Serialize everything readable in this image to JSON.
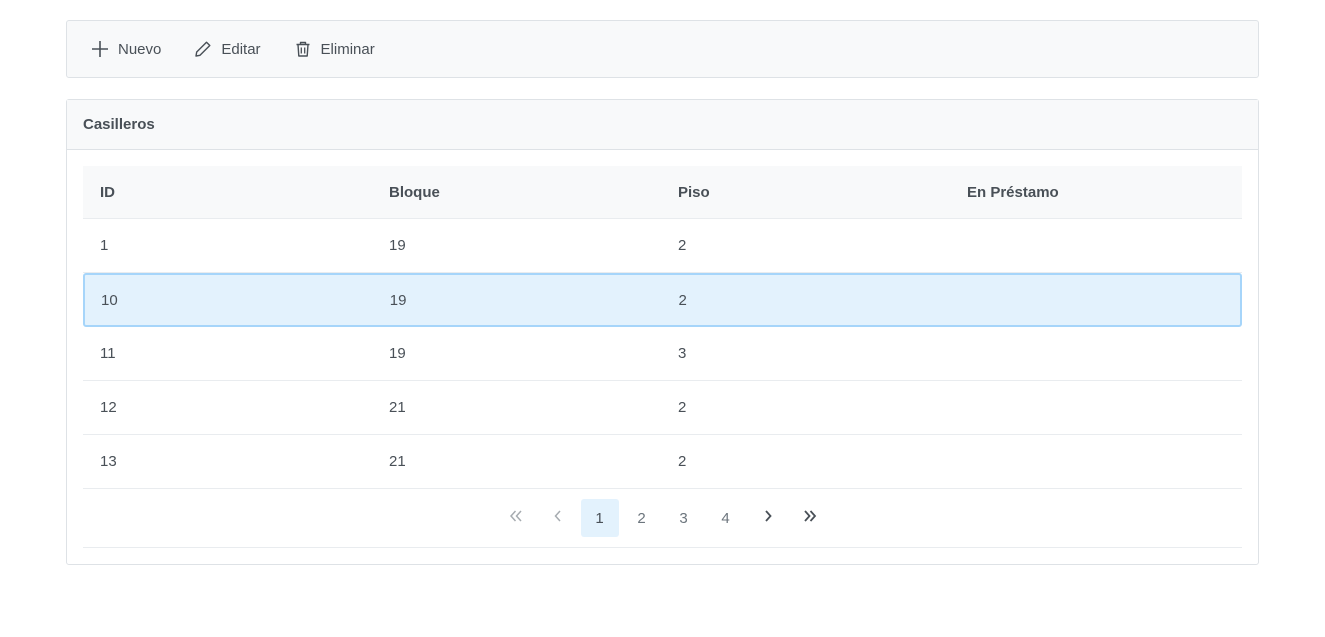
{
  "toolbar": {
    "buttons": [
      {
        "label": "Nuevo",
        "icon": "plus-icon"
      },
      {
        "label": "Editar",
        "icon": "pencil-icon"
      },
      {
        "label": "Eliminar",
        "icon": "trash-icon"
      }
    ]
  },
  "panel": {
    "title": "Casilleros"
  },
  "table": {
    "columns": [
      "ID",
      "Bloque",
      "Piso",
      "En Préstamo"
    ],
    "rows": [
      {
        "id": "1",
        "bloque": "19",
        "piso": "2",
        "prestamo": "",
        "selected": false
      },
      {
        "id": "10",
        "bloque": "19",
        "piso": "2",
        "prestamo": "",
        "selected": true
      },
      {
        "id": "11",
        "bloque": "19",
        "piso": "3",
        "prestamo": "",
        "selected": false
      },
      {
        "id": "12",
        "bloque": "21",
        "piso": "2",
        "prestamo": "",
        "selected": false
      },
      {
        "id": "13",
        "bloque": "21",
        "piso": "2",
        "prestamo": "",
        "selected": false
      }
    ]
  },
  "paginator": {
    "pages": [
      "1",
      "2",
      "3",
      "4"
    ],
    "current_page": "1",
    "first_icon": "double-chevron-left-icon",
    "prev_icon": "chevron-left-icon",
    "next_icon": "chevron-right-icon",
    "last_icon": "double-chevron-right-icon"
  },
  "colors": {
    "selected_row_bg": "#e3f2fd",
    "selected_row_border": "#a6d5fa",
    "header_bg": "#f8f9fa",
    "text": "#495057"
  }
}
